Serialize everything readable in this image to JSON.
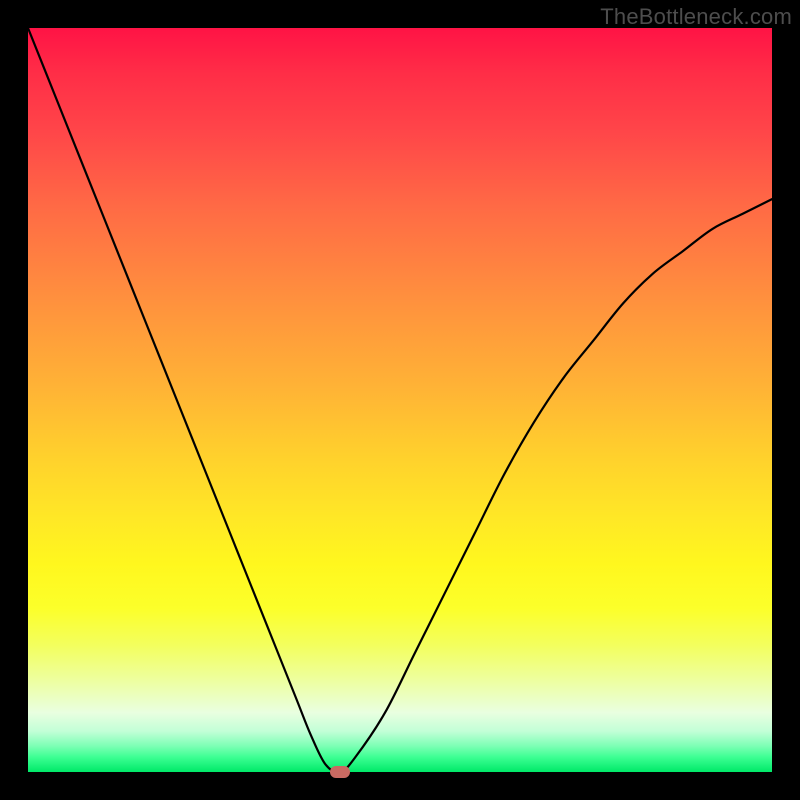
{
  "watermark": "TheBottleneck.com",
  "colors": {
    "frame": "#000000",
    "curve": "#000000",
    "marker": "#c96a62",
    "watermark_text": "#4d4d4d"
  },
  "chart_data": {
    "type": "line",
    "title": "",
    "xlabel": "",
    "ylabel": "",
    "xlim": [
      0,
      100
    ],
    "ylim": [
      0,
      100
    ],
    "grid": false,
    "legend": false,
    "annotations": [],
    "background_gradient": {
      "orientation": "vertical",
      "stops": [
        {
          "pos": 0.0,
          "color": "#ff1345"
        },
        {
          "pos": 0.24,
          "color": "#ff6a45"
        },
        {
          "pos": 0.48,
          "color": "#ffb236"
        },
        {
          "pos": 0.72,
          "color": "#fff71e"
        },
        {
          "pos": 0.88,
          "color": "#edffa4"
        },
        {
          "pos": 0.96,
          "color": "#7dffb5"
        },
        {
          "pos": 1.0,
          "color": "#00e968"
        }
      ]
    },
    "series": [
      {
        "name": "bottleneck-curve",
        "x": [
          0,
          4,
          8,
          12,
          16,
          20,
          24,
          28,
          32,
          36,
          38,
          40,
          42,
          44,
          48,
          52,
          56,
          60,
          64,
          68,
          72,
          76,
          80,
          84,
          88,
          92,
          96,
          100
        ],
        "y": [
          100,
          90,
          80,
          70,
          60,
          50,
          40,
          30,
          20,
          10,
          5,
          1,
          0,
          2,
          8,
          16,
          24,
          32,
          40,
          47,
          53,
          58,
          63,
          67,
          70,
          73,
          75,
          77
        ]
      }
    ],
    "marker": {
      "name": "optimal-point",
      "x": 42,
      "y": 0,
      "color": "#c96a62",
      "shape": "rounded-rect"
    }
  }
}
